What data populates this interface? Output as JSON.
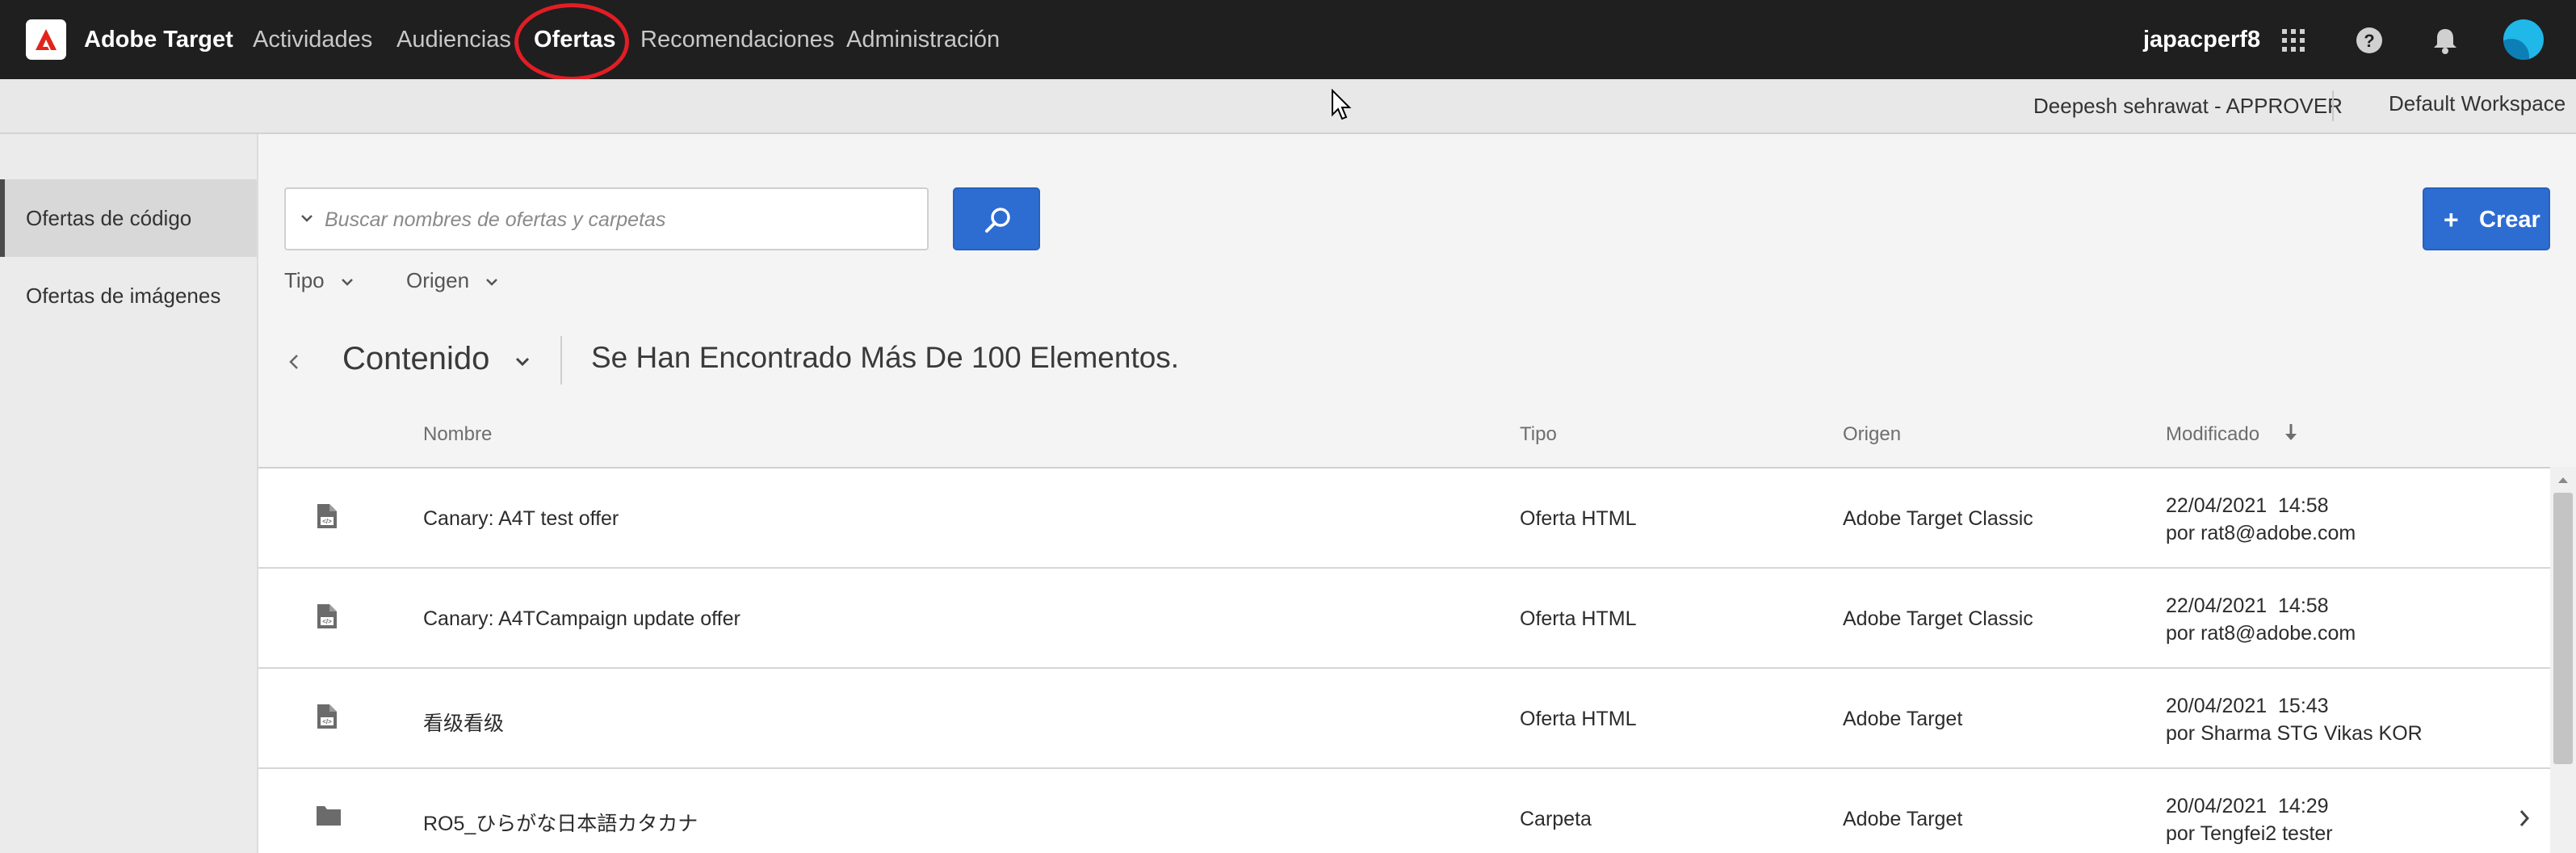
{
  "app": {
    "brand": "Adobe Target"
  },
  "nav": {
    "items": [
      {
        "label": "Actividades"
      },
      {
        "label": "Audiencias"
      },
      {
        "label": "Ofertas",
        "active": true
      },
      {
        "label": "Recomendaciones"
      },
      {
        "label": "Administración"
      }
    ],
    "username": "japacperf8"
  },
  "subbar": {
    "approver": "Deepesh sehrawat - APPROVER",
    "workspace": "Default Workspace"
  },
  "sidebar": {
    "items": [
      {
        "label": "Ofertas de código",
        "active": true
      },
      {
        "label": "Ofertas de imágenes"
      }
    ]
  },
  "search": {
    "placeholder": "Buscar nombres de ofertas y carpetas",
    "value": ""
  },
  "create_label": "Crear",
  "filters": {
    "type_label": "Tipo",
    "origin_label": "Origen"
  },
  "content": {
    "label": "Contenido",
    "found_text": "Se Han Encontrado Más De 100 Elementos."
  },
  "table": {
    "headers": {
      "name": "Nombre",
      "type": "Tipo",
      "origin": "Origen",
      "modified": "Modificado"
    },
    "rows": [
      {
        "icon": "html-offer-icon",
        "name": "Canary: A4T test offer",
        "type": "Oferta HTML",
        "origin": "Adobe Target Classic",
        "modified_date": "22/04/2021  14:58",
        "modified_by": "por rat8@adobe.com"
      },
      {
        "icon": "html-offer-icon",
        "name": "Canary: A4TCampaign update offer",
        "type": "Oferta HTML",
        "origin": "Adobe Target Classic",
        "modified_date": "22/04/2021  14:58",
        "modified_by": "por rat8@adobe.com"
      },
      {
        "icon": "html-offer-icon",
        "name": "看级看级",
        "type": "Oferta HTML",
        "origin": "Adobe Target",
        "modified_date": "20/04/2021  15:43",
        "modified_by": "por Sharma STG Vikas KOR"
      },
      {
        "icon": "folder-icon",
        "name": "RO5_ひらがな日本語カタカナ",
        "type": "Carpeta",
        "origin": "Adobe Target",
        "modified_date": "20/04/2021  14:29",
        "modified_by": "por Tengfei2 tester"
      }
    ]
  },
  "colors": {
    "topbar": "#1f1f1f",
    "accent": "#2d6dd2",
    "highlight_circle": "#e21d24",
    "avatar": "#1fb8e8"
  }
}
